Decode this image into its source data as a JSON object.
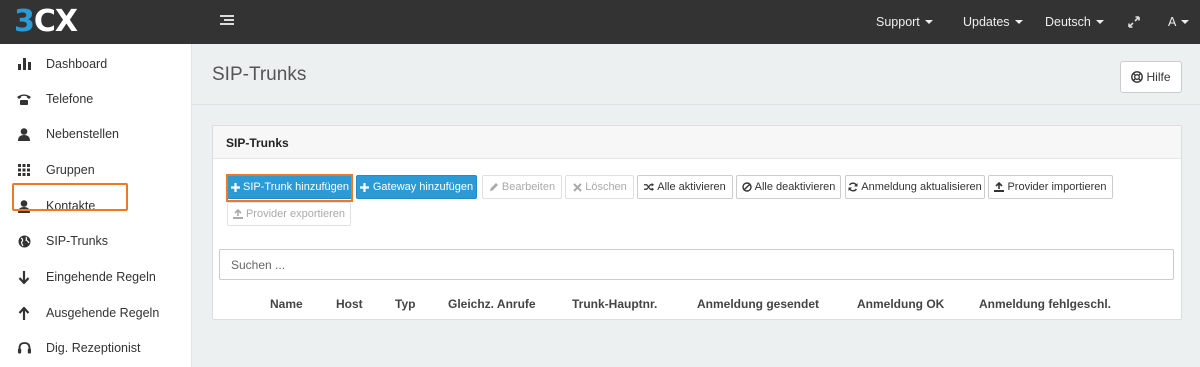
{
  "app": {
    "logo_text_a": "3",
    "logo_text_b": "CX"
  },
  "topnav": {
    "support": "Support",
    "updates": "Updates",
    "language": "Deutsch",
    "user": "A"
  },
  "sidebar": {
    "items": [
      {
        "label": "Dashboard",
        "icon": "bar-chart-icon"
      },
      {
        "label": "Telefone",
        "icon": "phone-icon"
      },
      {
        "label": "Nebenstellen",
        "icon": "user-icon"
      },
      {
        "label": "Gruppen",
        "icon": "grid-icon"
      },
      {
        "label": "Kontakte",
        "icon": "user-icon"
      },
      {
        "label": "SIP-Trunks",
        "icon": "globe-icon",
        "active": true
      },
      {
        "label": "Eingehende Regeln",
        "icon": "arrow-down-icon"
      },
      {
        "label": "Ausgehende Regeln",
        "icon": "arrow-up-icon"
      },
      {
        "label": "Dig. Rezeptionist",
        "icon": "headset-icon"
      }
    ]
  },
  "page": {
    "title": "SIP-Trunks",
    "help_label": "Hilfe"
  },
  "panel": {
    "title": "SIP-Trunks",
    "buttons": [
      {
        "label": "SIP-Trunk hinzufügen",
        "style": "primary",
        "icon": "plus-icon"
      },
      {
        "label": "Gateway hinzufügen",
        "style": "primary",
        "icon": "plus-icon"
      },
      {
        "label": "Bearbeiten",
        "style": "disabled",
        "icon": "pencil-icon"
      },
      {
        "label": "Löschen",
        "style": "disabled",
        "icon": "x-icon"
      },
      {
        "label": "Alle aktivieren",
        "style": "default",
        "icon": "shuffle-icon"
      },
      {
        "label": "Alle deaktivieren",
        "style": "default",
        "icon": "ban-icon"
      },
      {
        "label": "Anmeldung aktualisieren",
        "style": "default",
        "icon": "refresh-icon"
      },
      {
        "label": "Provider importieren",
        "style": "default",
        "icon": "upload-icon"
      },
      {
        "label": "Provider exportieren",
        "style": "disabled",
        "icon": "upload-icon"
      }
    ],
    "search_placeholder": "Suchen ...",
    "columns": [
      "Name",
      "Host",
      "Typ",
      "Gleichz. Anrufe",
      "Trunk-Hauptnr.",
      "Anmeldung gesendet",
      "Anmeldung OK",
      "Anmeldung fehlgeschl."
    ]
  },
  "colors": {
    "topbar": "#333333",
    "primary": "#2b9bd8",
    "highlight": "#f07820"
  }
}
